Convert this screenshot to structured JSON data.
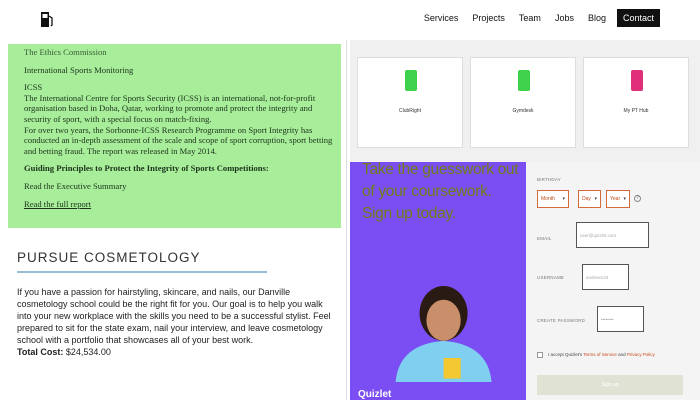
{
  "nav": {
    "logo_icon": "fuel-pump-icon",
    "items": [
      "Services",
      "Projects",
      "Team",
      "Jobs",
      "Blog"
    ],
    "contact": "Contact"
  },
  "ethics": {
    "cut_heading": "The Ethics Commission",
    "monitoring": "International Sports Monitoring",
    "icss_title": "ICSS",
    "body1": "The International Centre for Sports Security (ICSS) is an international, not-for-profit organisation based in Doha, Qatar, working to promote and protect the integrity and security of sport, with a special focus on match-fixing.",
    "body2": "For over two years, the Sorbonne-ICSS Research Programme on Sport Integrity has conducted an in-depth assessment of the scale and scope of sport corruption, sport betting and betting fraud. The report was released in May 2014.",
    "guiding": "Guiding Principles to Protect the Integrity of Sports Competitions:",
    "exec_summary": "Read the Executive Summary",
    "full_report": "Read the full report"
  },
  "cosmetology": {
    "heading": "PURSUE COSMETOLOGY",
    "body": "If you have a passion for hairstyling, skincare, and nails, our Danville cosmetology school could be the right fit for you. Our goal is to help you walk into your new workplace with the skills you need to be a successful stylist. Feel prepared to sit for the state exam, nail your interview, and leave cosmetology school with a portfolio that showcases all of your best work.",
    "total_label": "Total Cost:",
    "total_value": "$24,534.00"
  },
  "cards": [
    {
      "label": "ClubRight",
      "icon": "clubright-logo-icon",
      "color": "#3fd14a"
    },
    {
      "label": "Gymdesk",
      "icon": "gymdesk-logo-icon",
      "color": "#3fd14a"
    },
    {
      "label": "My PT Hub",
      "icon": "my-pt-hub-logo-icon",
      "color": "#e0307a"
    }
  ],
  "promo": {
    "line1": "Take the guesswork out",
    "line2": "of your coursework.",
    "line3": "Sign up today.",
    "brand": "Quizlet"
  },
  "form": {
    "birthday_label": "BIRTHDAY",
    "month": "Month",
    "day": "Day",
    "year": "Year",
    "email_label": "EMAIL",
    "email_placeholder": "user@quizlet.com",
    "username_label": "USERNAME",
    "username_placeholder": "andrew123",
    "password_label": "CREATE PASSWORD",
    "password_placeholder": "••••••••",
    "terms_prefix": "I accept Quizlet's",
    "terms_link1": "Terms of Service",
    "terms_and": "and",
    "terms_link2": "Privacy Policy",
    "signup": "Sign up"
  },
  "colors": {
    "ethics_bg": "#a8ee9a",
    "promo_bg": "#7a4ef2",
    "accent": "#d46a3a"
  }
}
